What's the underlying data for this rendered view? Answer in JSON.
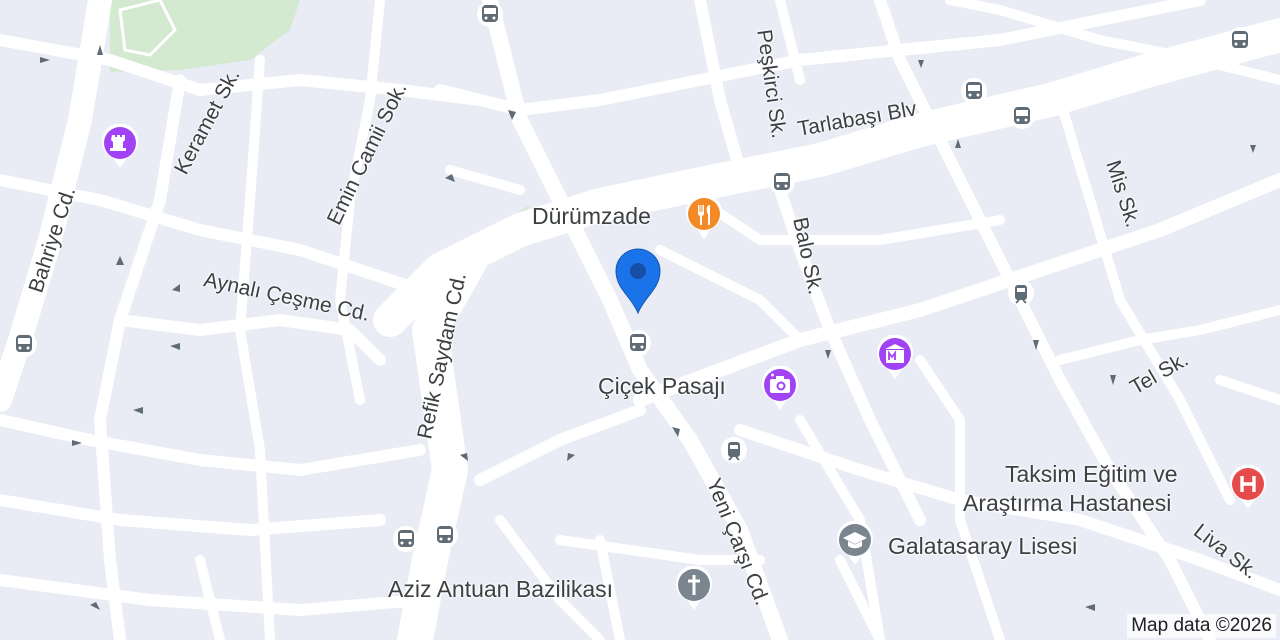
{
  "streets": {
    "tarlabasi": "Tarlabaşı Blv",
    "peskirci": "Peşkirci Sk.",
    "keramet": "Keramet Sk.",
    "emin_camii": "Emin Camii Sok.",
    "bahriye": "Bahriye Cd.",
    "aynali_cesme": "Aynalı Çeşme Cd.",
    "refik_saydam": "Refik Saydam Cd.",
    "balo": "Balo Sk.",
    "mis": "Mis Sk.",
    "tel": "Tel Sk.",
    "yeni_carsi": "Yeni Çarşı Cd.",
    "liva": "Liva Sk."
  },
  "pois": {
    "durumzade": "Dürümzade",
    "cicek_pasaji": "Çiçek Pasajı",
    "hospital_line1": "Taksim Eğitim ve",
    "hospital_line2": "Araştırma Hastanesi",
    "galatasaray": "Galatasaray Lisesi",
    "aziz_antuan": "Aziz Antuan Bazilikası"
  },
  "icons": {
    "restaurant": "fork-knife-icon",
    "camera": "camera-icon",
    "museum": "museum-icon",
    "hospital": "hospital-icon",
    "school": "graduation-cap-icon",
    "church": "cross-icon",
    "castle": "castle-icon",
    "bus": "bus-stop-icon",
    "tram": "tram-stop-icon",
    "location": "location-pin-icon"
  },
  "colors": {
    "background": "#e9ebf5",
    "road": "#ffffff",
    "park": "#cfe8cf",
    "restaurant": "#f28b27",
    "purple_poi": "#a142f4",
    "hospital": "#e64a4a",
    "gray_poi": "#7a8590",
    "pin": "#1a73e8",
    "transit": "#5f6b75"
  },
  "attribution": "Map data ©2026"
}
